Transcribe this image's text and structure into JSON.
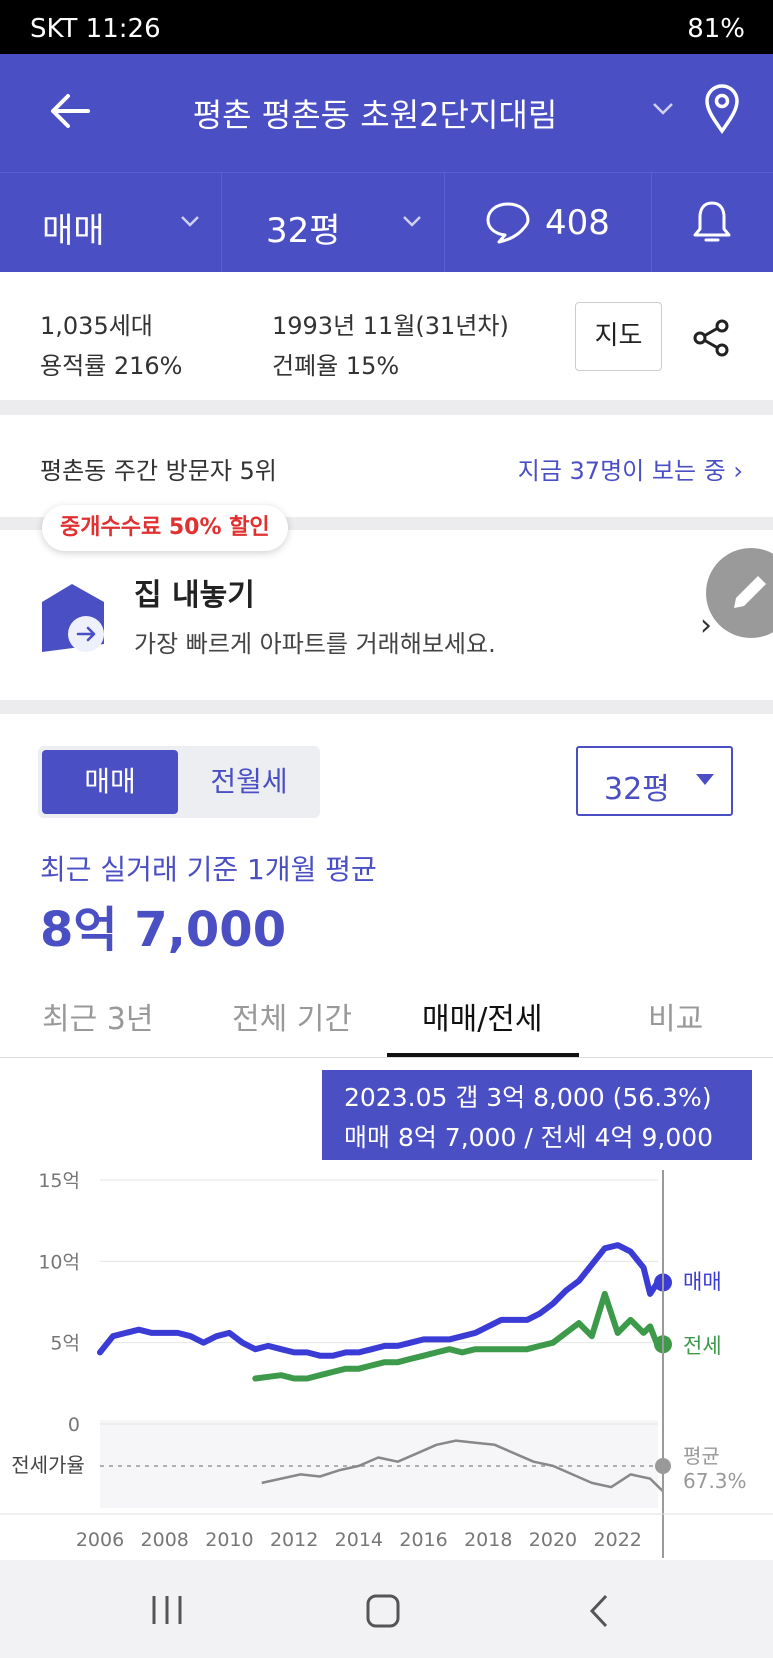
{
  "status_bar": {
    "left": "SKT 11:26",
    "right": "81%"
  },
  "header": {
    "title": "평촌 평촌동 초원2단지대림"
  },
  "filters": {
    "trade_type": "매매",
    "size": "32평",
    "comments": "408"
  },
  "complex": {
    "households": "1,035세대",
    "built": "1993년 11월(31년차)",
    "far": "용적률 216%",
    "bcr": "건폐율 15%",
    "map_button": "지도"
  },
  "visitors": {
    "rank": "평촌동 주간 방문자 5위",
    "viewing": "지금 37명이 보는 중"
  },
  "promo": {
    "badge": "중개수수료 50% 할인",
    "title": "집 내놓기",
    "subtitle": "가장 빠르게 아파트를 거래해보세요."
  },
  "price": {
    "seg_active": "매매",
    "seg_inactive": "전월세",
    "size": "32평",
    "caption": "최근 실거래 기준 1개월 평균",
    "value": "8억 7,000"
  },
  "period_tabs": [
    "최근 3년",
    "전체 기간",
    "매매/전세",
    "비교"
  ],
  "tooltip": {
    "line1": "2023.05  갭 3억 8,000 (56.3%)",
    "line2": "매매 8억 7,000 / 전세 4억 9,000"
  },
  "colors": {
    "sale": "#3b3bd6",
    "jeonse": "#3d9a4a",
    "ratio": "#888888",
    "accent": "#4b4fc4"
  },
  "chart_data": {
    "type": "line",
    "xlabels": [
      "2006",
      "2008",
      "2010",
      "2012",
      "2014",
      "2016",
      "2018",
      "2020",
      "2022"
    ],
    "y_ticks": [
      "15억",
      "10억",
      "5억",
      "0"
    ],
    "ylim": [
      0,
      15
    ],
    "y_unit": "억",
    "series": [
      {
        "name": "매매",
        "color": "#3b3bd6",
        "x": [
          2006.0,
          2006.4,
          2006.8,
          2007.2,
          2007.6,
          2008.0,
          2008.4,
          2008.8,
          2009.2,
          2009.6,
          2010.0,
          2010.4,
          2010.8,
          2011.2,
          2011.6,
          2012.0,
          2012.4,
          2012.8,
          2013.2,
          2013.6,
          2014.0,
          2014.4,
          2014.8,
          2015.2,
          2015.6,
          2016.0,
          2016.4,
          2016.8,
          2017.2,
          2017.6,
          2018.0,
          2018.4,
          2018.8,
          2019.2,
          2019.6,
          2020.0,
          2020.4,
          2020.8,
          2021.2,
          2021.6,
          2022.0,
          2022.4,
          2022.8,
          2023.0,
          2023.2,
          2023.4
        ],
        "values": [
          4.4,
          5.4,
          5.6,
          5.8,
          5.6,
          5.6,
          5.6,
          5.4,
          5.0,
          5.4,
          5.6,
          5.0,
          4.6,
          4.8,
          4.6,
          4.4,
          4.4,
          4.2,
          4.2,
          4.4,
          4.4,
          4.6,
          4.8,
          4.8,
          5.0,
          5.2,
          5.2,
          5.2,
          5.4,
          5.6,
          6.0,
          6.4,
          6.4,
          6.4,
          6.8,
          7.4,
          8.2,
          8.8,
          9.8,
          10.8,
          11.0,
          10.6,
          9.6,
          8.0,
          8.6,
          8.7
        ]
      },
      {
        "name": "전세",
        "color": "#3d9a4a",
        "x": [
          2010.8,
          2011.2,
          2011.6,
          2012.0,
          2012.4,
          2012.8,
          2013.2,
          2013.6,
          2014.0,
          2014.4,
          2014.8,
          2015.2,
          2015.6,
          2016.0,
          2016.4,
          2016.8,
          2017.2,
          2017.6,
          2018.0,
          2018.4,
          2018.8,
          2019.2,
          2019.6,
          2020.0,
          2020.4,
          2020.8,
          2021.2,
          2021.6,
          2022.0,
          2022.4,
          2022.8,
          2023.0,
          2023.2,
          2023.4
        ],
        "values": [
          2.8,
          2.9,
          3.0,
          2.8,
          2.8,
          3.0,
          3.2,
          3.4,
          3.4,
          3.6,
          3.8,
          3.8,
          4.0,
          4.2,
          4.4,
          4.6,
          4.4,
          4.6,
          4.6,
          4.6,
          4.6,
          4.6,
          4.8,
          5.0,
          5.6,
          6.2,
          5.4,
          8.0,
          5.6,
          6.4,
          5.6,
          6.0,
          5.0,
          4.9
        ]
      }
    ],
    "ratio": {
      "label": "전세가율",
      "avg_label": "평균",
      "avg_value": "67.3%",
      "x": [
        2011.0,
        2011.6,
        2012.2,
        2012.8,
        2013.4,
        2014.0,
        2014.6,
        2015.2,
        2015.8,
        2016.4,
        2017.0,
        2017.6,
        2018.2,
        2018.8,
        2019.4,
        2020.0,
        2020.6,
        2021.2,
        2021.8,
        2022.4,
        2023.0,
        2023.4
      ],
      "values": [
        60,
        62,
        64,
        63,
        66,
        68,
        72,
        70,
        74,
        78,
        80,
        79,
        78,
        74,
        70,
        68,
        64,
        60,
        58,
        64,
        62,
        56
      ]
    },
    "selected": {
      "date": "2023.05",
      "x": 2023.4
    }
  }
}
